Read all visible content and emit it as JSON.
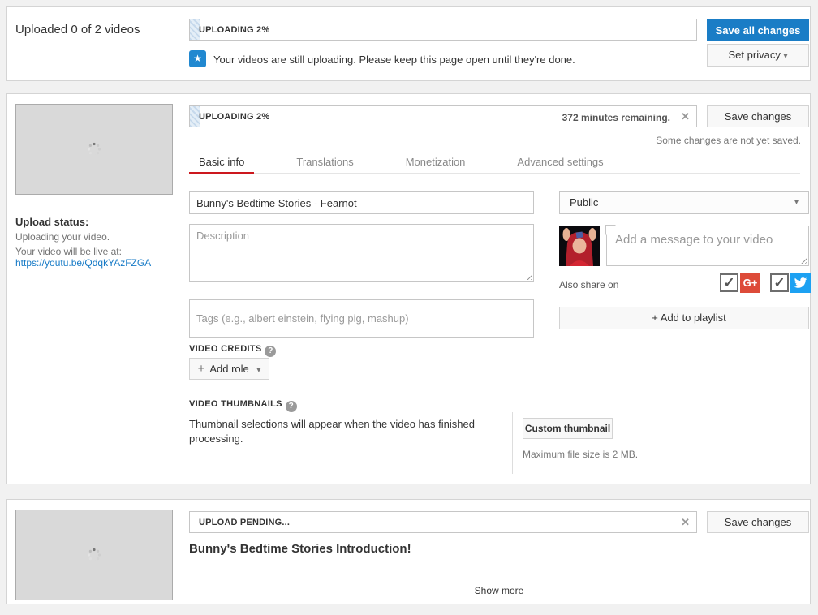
{
  "header": {
    "title": "Uploaded 0 of 2 videos",
    "progress_label": "UPLOADING 2%",
    "save_all_label": "Save all changes",
    "set_privacy_label": "Set privacy",
    "notice": "Your videos are still uploading. Please keep this page open until they're done."
  },
  "video1": {
    "progress_label": "UPLOADING 2%",
    "time_remaining": "372 minutes remaining.",
    "save_label": "Save changes",
    "unsaved_note": "Some changes are not yet saved.",
    "tabs": [
      "Basic info",
      "Translations",
      "Monetization",
      "Advanced settings"
    ],
    "upload_status": {
      "heading": "Upload status:",
      "line1": "Uploading your video.",
      "line2": "Your video will be live at:",
      "link": "https://youtu.be/QdqkYAzFZGA"
    },
    "title_value": "Bunny's Bedtime Stories - Fearnot",
    "description_placeholder": "Description",
    "tags_placeholder": "Tags (e.g., albert einstein, flying pig, mashup)",
    "privacy_value": "Public",
    "message_placeholder": "Add a message to your video",
    "also_share_label": "Also share on",
    "add_to_playlist_label": "+ Add to playlist",
    "video_credits_label": "VIDEO CREDITS",
    "add_role_label": "Add role",
    "video_thumbnails_label": "VIDEO THUMBNAILS",
    "thumbnails_note": "Thumbnail selections will appear when the video has finished processing.",
    "custom_thumbnail_label": "Custom thumbnail",
    "max_file_note": "Maximum file size is 2 MB."
  },
  "video2": {
    "progress_label": "UPLOAD PENDING...",
    "save_label": "Save changes",
    "title": "Bunny's Bedtime Stories Introduction!",
    "show_more_label": "Show more"
  },
  "icons": {
    "close": "✕",
    "caret": "▾",
    "star": "★",
    "help": "?",
    "plus": "+",
    "gplus": "G+",
    "check": "✓"
  },
  "colors": {
    "accent_blue": "#1a7dc6",
    "link_blue": "#167ac6",
    "tab_red": "#cc181e",
    "gplus_red": "#dd4b39",
    "twitter_blue": "#1da1f2"
  }
}
